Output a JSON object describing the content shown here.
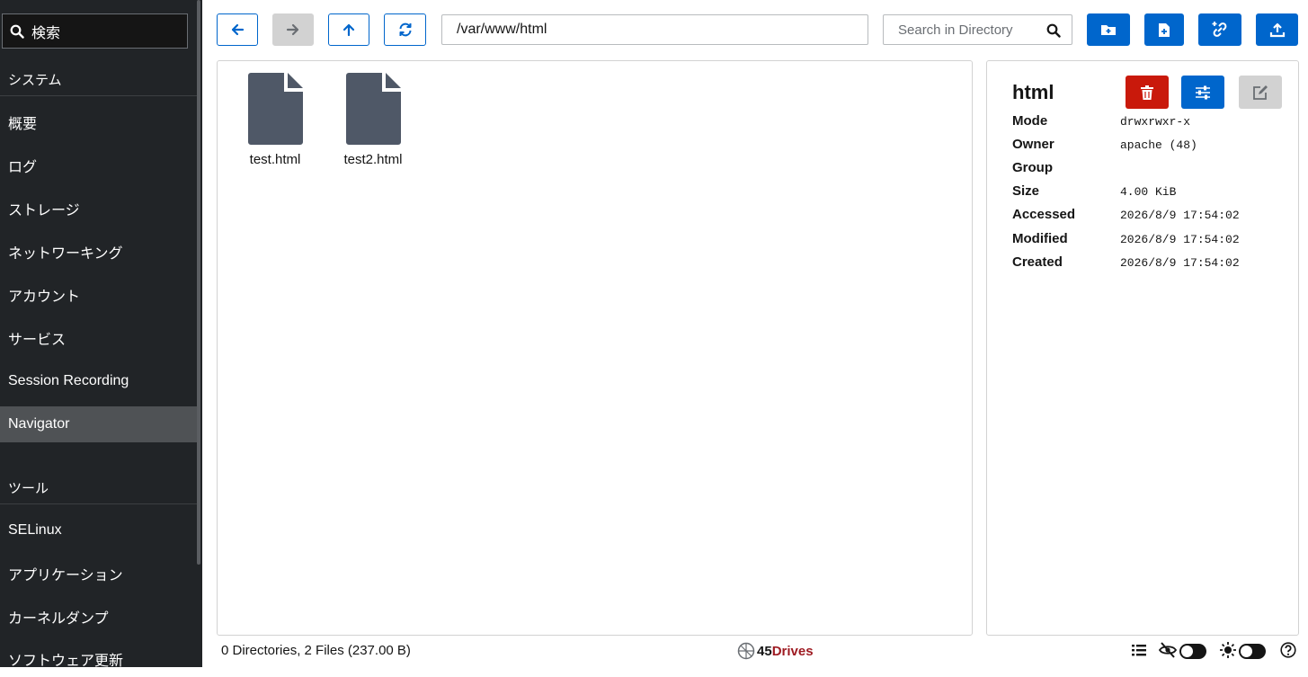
{
  "sidebar": {
    "search_label": "検索",
    "sections": [
      {
        "heading": "システム",
        "items": [
          "概要",
          "ログ",
          "ストレージ",
          "ネットワーキング",
          "アカウント",
          "サービス",
          "Session Recording",
          "Navigator"
        ]
      },
      {
        "heading": "ツール",
        "items": [
          "SELinux",
          "アプリケーション",
          "カーネルダンプ",
          "ソフトウェア更新"
        ]
      }
    ],
    "active_item": "Navigator"
  },
  "toolbar": {
    "path": "/var/www/html",
    "search_placeholder": "Search in Directory"
  },
  "files": [
    {
      "name": "test.html"
    },
    {
      "name": "test2.html"
    }
  ],
  "details": {
    "title": "html",
    "properties": [
      {
        "key": "Mode",
        "value": "drwxrwxr-x"
      },
      {
        "key": "Owner",
        "value": "apache (48)"
      },
      {
        "key": "Group",
        "value": ""
      },
      {
        "key": "Size",
        "value": "4.00 KiB"
      },
      {
        "key": "Accessed",
        "value": "2026/8/9 17:54:02"
      },
      {
        "key": "Modified",
        "value": "2026/8/9 17:54:02"
      },
      {
        "key": "Created",
        "value": "2026/8/9 17:54:02"
      }
    ]
  },
  "footer": {
    "summary": "0 Directories, 2 Files (237.00 B)",
    "brand_number": "45",
    "brand_word": "Drives"
  },
  "colors": {
    "accent": "#0066cc",
    "danger": "#c9190b",
    "sidebar_bg": "#212427",
    "file_icon": "#4f5867"
  }
}
